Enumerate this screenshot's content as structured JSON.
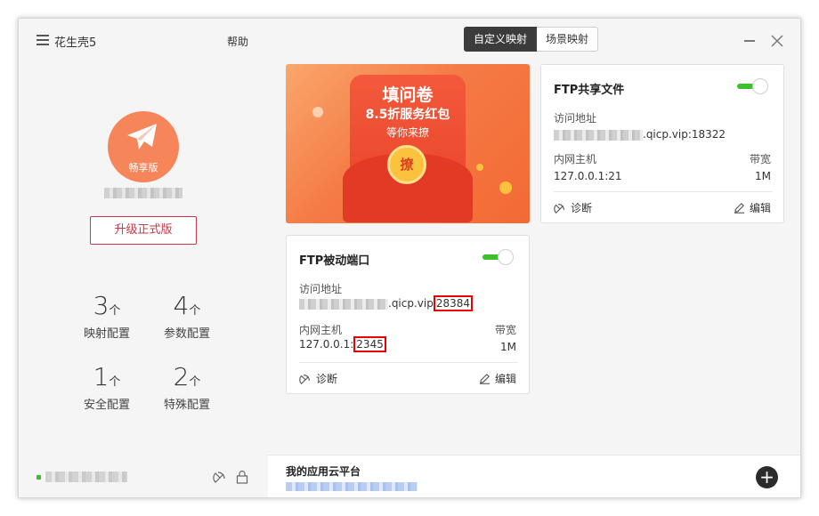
{
  "app": {
    "name": "花生壳5",
    "help": "帮助",
    "edition": "畅享版",
    "upgrade": "升级正式版"
  },
  "stats": [
    {
      "num": "3",
      "unit": "个",
      "label": "映射配置"
    },
    {
      "num": "4",
      "unit": "个",
      "label": "参数配置"
    },
    {
      "num": "1",
      "unit": "个",
      "label": "安全配置"
    },
    {
      "num": "2",
      "unit": "个",
      "label": "特殊配置"
    }
  ],
  "tabs": {
    "active": "自定义映射",
    "inactive": "场景映射"
  },
  "banner": {
    "title": "填问卷",
    "line2": "8.5折服务红包",
    "line3": "等你来撩",
    "coin": "撩"
  },
  "cards": [
    {
      "title": "FTP共享文件",
      "enabled": true,
      "addr_label": "访问地址",
      "addr_suffix": ".qicp.vip:18322",
      "host_label": "内网主机",
      "host_value": "127.0.0.1:21",
      "bw_label": "带宽",
      "bw_value": "1M",
      "diag": "诊断",
      "edit": "编辑"
    },
    {
      "title": "FTP被动端口",
      "enabled": true,
      "addr_label": "访问地址",
      "addr_mid": ".qicp.vip",
      "addr_port": "28384",
      "host_label": "内网主机",
      "host_prefix": "127.0.0.1:",
      "host_port": "2345",
      "bw_label": "带宽",
      "bw_value": "1M",
      "diag": "诊断",
      "edit": "编辑"
    }
  ],
  "platform": {
    "title": "我的应用云平台",
    "add": "+"
  },
  "colors": {
    "accent": "#3ebf2c",
    "upgrade": "#c8374a",
    "avatar": "#f7855a",
    "highlight": "#e00000"
  }
}
